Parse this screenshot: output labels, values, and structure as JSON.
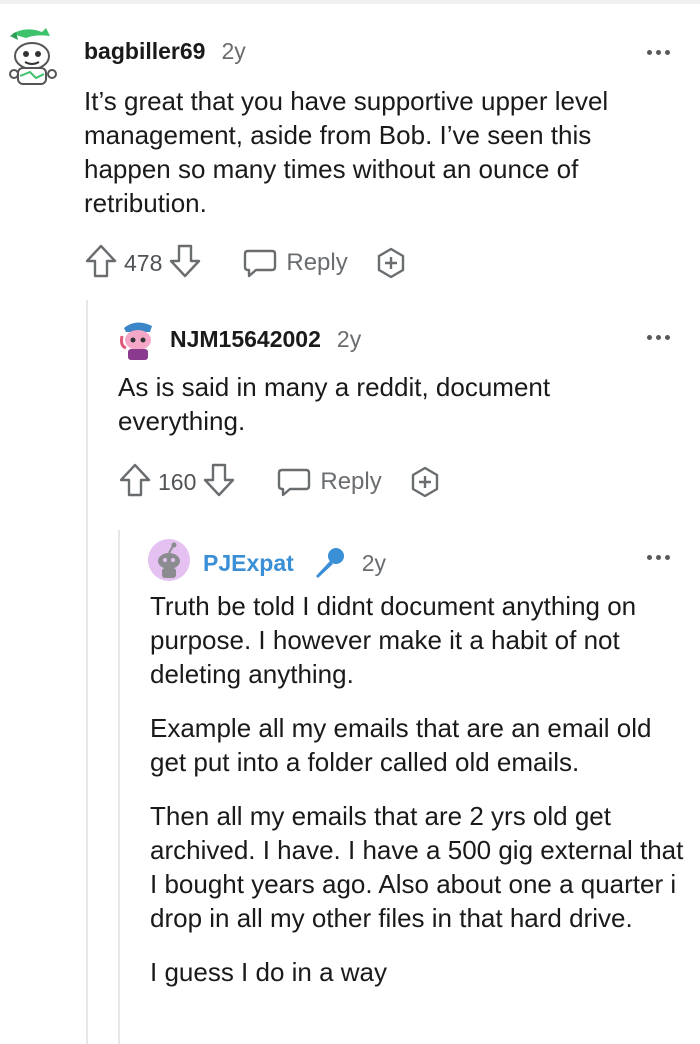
{
  "comments": [
    {
      "username": "bagbiller69",
      "time": "2y",
      "body": [
        "It’s great that you have supportive upper level management, aside from Bob. I’ve seen this happen so many times without an ounce of retribution."
      ],
      "votes": "478",
      "reply_label": "Reply"
    },
    {
      "username": "NJM15642002",
      "time": "2y",
      "body": [
        "As is said in many a reddit, document everything."
      ],
      "votes": "160",
      "reply_label": "Reply"
    },
    {
      "username": "PJExpat",
      "time": "2y",
      "body": [
        "Truth be told I didnt document anything on purpose. I however make it a habit of not deleting anything.",
        "Example all my emails that are an email old get put into a folder called old emails.",
        "Then all my emails that are 2 yrs old get archived. I have. I have a 500 gig external that I bought years ago. Also about one a quarter i drop in all my other files in that hard drive.",
        "I guess I do in a way"
      ]
    }
  ],
  "colors": {
    "op_username": "#3a8fd6",
    "text": "#1a1a1b",
    "muted": "#6a6d70"
  },
  "icons": [
    "upvote-icon",
    "downvote-icon",
    "reply-icon",
    "award-icon",
    "more-options-icon",
    "microphone-icon"
  ]
}
